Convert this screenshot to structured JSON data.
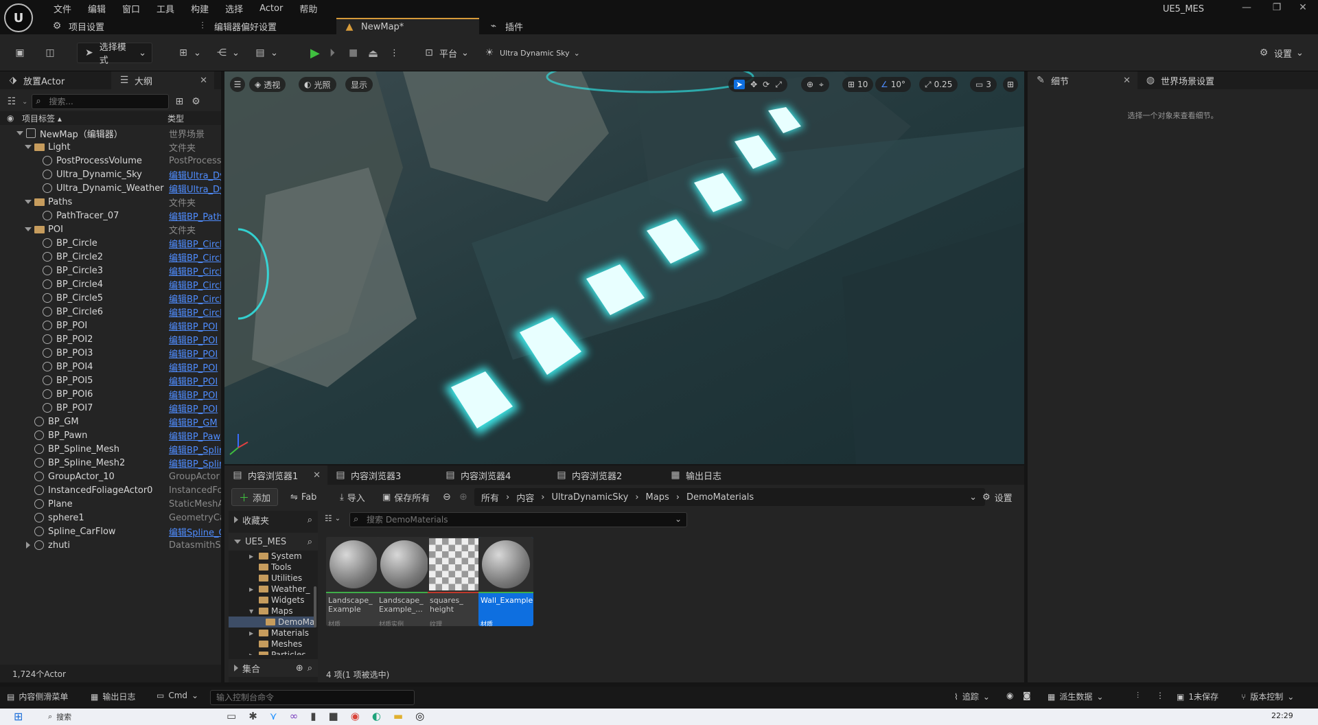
{
  "app": {
    "window_title": "UE5_MES",
    "menu": [
      "文件",
      "编辑",
      "窗口",
      "工具",
      "构建",
      "选择",
      "Actor",
      "帮助"
    ],
    "title_tabs": [
      {
        "label": "项目设置"
      },
      {
        "label": "编辑器偏好设置"
      },
      {
        "label": "NewMap*"
      },
      {
        "label": "插件"
      }
    ]
  },
  "toolbar": {
    "mode_label": "选择模式",
    "platform_label": "平台",
    "sky_label": "Ultra Dynamic Sky",
    "settings_label": "设置"
  },
  "outliner": {
    "tabs": [
      {
        "label": "放置Actor"
      },
      {
        "label": "大纲"
      }
    ],
    "search_placeholder": "搜索...",
    "col_label": "项目标签",
    "col_type": "类型",
    "rows": [
      {
        "name": "NewMap（编辑器）",
        "type": "世界场景",
        "depth": 0,
        "kind": "map",
        "expand": "open",
        "link": false
      },
      {
        "name": "Light",
        "type": "文件夹",
        "depth": 1,
        "kind": "folder",
        "expand": "open",
        "link": false
      },
      {
        "name": "PostProcessVolume",
        "type": "PostProcess'",
        "depth": 2,
        "kind": "actor",
        "expand": "none",
        "link": false
      },
      {
        "name": "Ultra_Dynamic_Sky",
        "type": "编辑Ultra_Dy",
        "depth": 2,
        "kind": "actor",
        "expand": "none",
        "link": true
      },
      {
        "name": "Ultra_Dynamic_Weather",
        "type": "编辑Ultra_Dy",
        "depth": 2,
        "kind": "actor",
        "expand": "none",
        "link": true
      },
      {
        "name": "Paths",
        "type": "文件夹",
        "depth": 1,
        "kind": "folder",
        "expand": "open",
        "link": false
      },
      {
        "name": "PathTracer_07",
        "type": "编辑BP_Path",
        "depth": 2,
        "kind": "actor",
        "expand": "none",
        "link": true
      },
      {
        "name": "POI",
        "type": "文件夹",
        "depth": 1,
        "kind": "folder",
        "expand": "open",
        "link": false
      },
      {
        "name": "BP_Circle",
        "type": "编辑BP_Circl",
        "depth": 2,
        "kind": "actor",
        "expand": "none",
        "link": true
      },
      {
        "name": "BP_Circle2",
        "type": "编辑BP_Circl",
        "depth": 2,
        "kind": "actor",
        "expand": "none",
        "link": true
      },
      {
        "name": "BP_Circle3",
        "type": "编辑BP_Circl",
        "depth": 2,
        "kind": "actor",
        "expand": "none",
        "link": true
      },
      {
        "name": "BP_Circle4",
        "type": "编辑BP_Circl",
        "depth": 2,
        "kind": "actor",
        "expand": "none",
        "link": true
      },
      {
        "name": "BP_Circle5",
        "type": "编辑BP_Circl",
        "depth": 2,
        "kind": "actor",
        "expand": "none",
        "link": true
      },
      {
        "name": "BP_Circle6",
        "type": "编辑BP_Circl",
        "depth": 2,
        "kind": "actor",
        "expand": "none",
        "link": true
      },
      {
        "name": "BP_POI",
        "type": "编辑BP_POI",
        "depth": 2,
        "kind": "actor",
        "expand": "none",
        "link": true
      },
      {
        "name": "BP_POI2",
        "type": "编辑BP_POI",
        "depth": 2,
        "kind": "actor",
        "expand": "none",
        "link": true
      },
      {
        "name": "BP_POI3",
        "type": "编辑BP_POI",
        "depth": 2,
        "kind": "actor",
        "expand": "none",
        "link": true
      },
      {
        "name": "BP_POI4",
        "type": "编辑BP_POI",
        "depth": 2,
        "kind": "actor",
        "expand": "none",
        "link": true
      },
      {
        "name": "BP_POI5",
        "type": "编辑BP_POI",
        "depth": 2,
        "kind": "actor",
        "expand": "none",
        "link": true
      },
      {
        "name": "BP_POI6",
        "type": "编辑BP_POI",
        "depth": 2,
        "kind": "actor",
        "expand": "none",
        "link": true
      },
      {
        "name": "BP_POI7",
        "type": "编辑BP_POI",
        "depth": 2,
        "kind": "actor",
        "expand": "none",
        "link": true
      },
      {
        "name": "BP_GM",
        "type": "编辑BP_GM",
        "depth": 1,
        "kind": "actor",
        "expand": "none",
        "link": true
      },
      {
        "name": "BP_Pawn",
        "type": "编辑BP_Paw",
        "depth": 1,
        "kind": "actor",
        "expand": "none",
        "link": true
      },
      {
        "name": "BP_Spline_Mesh",
        "type": "编辑BP_Splir",
        "depth": 1,
        "kind": "actor",
        "expand": "none",
        "link": true
      },
      {
        "name": "BP_Spline_Mesh2",
        "type": "编辑BP_Splir",
        "depth": 1,
        "kind": "actor",
        "expand": "none",
        "link": true
      },
      {
        "name": "GroupActor_10",
        "type": "GroupActor",
        "depth": 1,
        "kind": "actor",
        "expand": "none",
        "link": false
      },
      {
        "name": "InstancedFoliageActor0",
        "type": "InstancedFoli",
        "depth": 1,
        "kind": "actor",
        "expand": "none",
        "link": false
      },
      {
        "name": "Plane",
        "type": "StaticMeshAc",
        "depth": 1,
        "kind": "actor",
        "expand": "none",
        "link": false
      },
      {
        "name": "sphere1",
        "type": "GeometryCac",
        "depth": 1,
        "kind": "actor",
        "expand": "none",
        "link": false
      },
      {
        "name": "Spline_CarFlow",
        "type": "编辑Spline_C",
        "depth": 1,
        "kind": "actor",
        "expand": "none",
        "link": true
      },
      {
        "name": "zhuti",
        "type": "DatasmithSc",
        "depth": 1,
        "kind": "actor",
        "expand": "closed",
        "link": false
      }
    ],
    "actor_count": "1,724个Actor"
  },
  "viewport": {
    "buttons": {
      "perspective": "透视",
      "lit": "光照",
      "show": "显示"
    },
    "snap": {
      "grid": "10",
      "angle": "10°",
      "scale": "0.25",
      "camera": "3"
    }
  },
  "content_browser": {
    "tabs": [
      {
        "label": "内容浏览器1"
      },
      {
        "label": "内容浏览器3"
      },
      {
        "label": "内容浏览器4"
      },
      {
        "label": "内容浏览器2"
      },
      {
        "label": "输出日志"
      }
    ],
    "add_label": "添加",
    "fab_label": "Fab",
    "import_label": "导入",
    "save_all_label": "保存所有",
    "settings_label": "设置",
    "breadcrumb": [
      "所有",
      "内容",
      "UltraDynamicSky",
      "Maps",
      "DemoMaterials"
    ],
    "favorites_label": "收藏夹",
    "project_label": "UE5_MES",
    "collections_label": "集合",
    "search_placeholder": "搜索 DemoMaterials",
    "tree": [
      {
        "name": "System",
        "depth": 3,
        "expand": "closed"
      },
      {
        "name": "Tools",
        "depth": 3,
        "expand": "none"
      },
      {
        "name": "Utilities",
        "depth": 3,
        "expand": "none"
      },
      {
        "name": "Weather_",
        "depth": 3,
        "expand": "closed"
      },
      {
        "name": "Widgets",
        "depth": 3,
        "expand": "none"
      },
      {
        "name": "Maps",
        "depth": 3,
        "expand": "open"
      },
      {
        "name": "DemoMa",
        "depth": 4,
        "expand": "none",
        "selected": true
      },
      {
        "name": "Materials",
        "depth": 3,
        "expand": "closed"
      },
      {
        "name": "Meshes",
        "depth": 3,
        "expand": "none"
      },
      {
        "name": "Particles",
        "depth": 3,
        "expand": "closed"
      }
    ],
    "assets": [
      {
        "name": "Landscape_ Example",
        "type": "材质",
        "thumb": "ball",
        "bar": "#3fae49",
        "selected": false
      },
      {
        "name": "Landscape_ Example_...",
        "type": "材质实例",
        "thumb": "ball",
        "bar": "#3fae49",
        "selected": false
      },
      {
        "name": "squares_ height",
        "type": "纹理",
        "thumb": "checker",
        "bar": "#c0392b",
        "selected": false
      },
      {
        "name": "Wall_Example",
        "type": "材质",
        "thumb": "ball",
        "bar": "#3fae49",
        "selected": true
      }
    ],
    "status": "4 项(1 项被选中)"
  },
  "details": {
    "tabs": [
      {
        "label": "细节"
      },
      {
        "label": "世界场景设置"
      }
    ],
    "empty_text": "选择一个对象来查看细节。"
  },
  "statusbar": {
    "drawer_label": "内容侧滑菜单",
    "output_label": "输出日志",
    "cmd_label": "Cmd",
    "cmd_placeholder": "输入控制台命令",
    "trace_label": "追踪",
    "derived_label": "派生数据",
    "unsaved_label": "1未保存",
    "version_label": "版本控制"
  },
  "taskbar": {
    "search_label": "搜索",
    "time": "22:29"
  },
  "colors": {
    "accent": "#d79b3a",
    "link": "#4f8dff",
    "selected": "#0e6fe0",
    "glow": "#3ff5f5"
  }
}
